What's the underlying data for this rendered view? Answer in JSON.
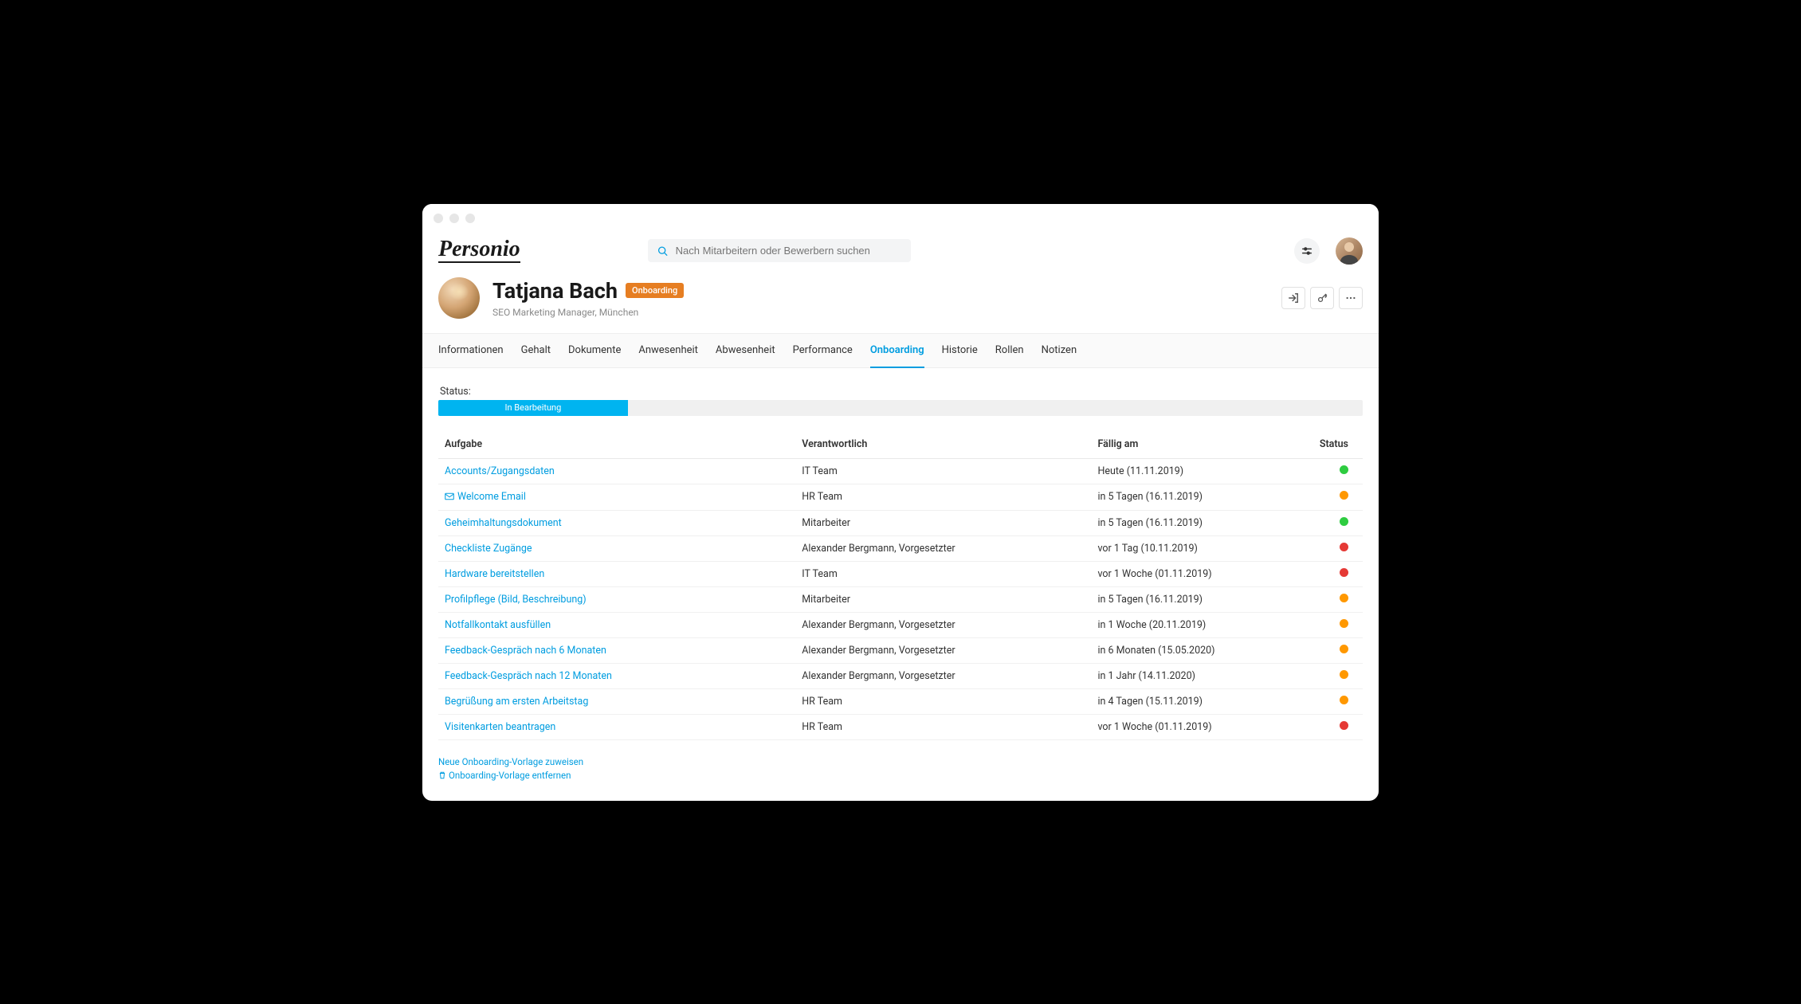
{
  "logo": "Personio",
  "search": {
    "placeholder": "Nach Mitarbeitern oder Bewerbern suchen"
  },
  "profile": {
    "name": "Tatjana Bach",
    "badge": "Onboarding",
    "subtitle": "SEO Marketing Manager, München"
  },
  "tabs": [
    {
      "label": "Informationen",
      "active": false
    },
    {
      "label": "Gehalt",
      "active": false
    },
    {
      "label": "Dokumente",
      "active": false
    },
    {
      "label": "Anwesenheit",
      "active": false
    },
    {
      "label": "Abwesenheit",
      "active": false
    },
    {
      "label": "Performance",
      "active": false
    },
    {
      "label": "Onboarding",
      "active": true
    },
    {
      "label": "Historie",
      "active": false
    },
    {
      "label": "Rollen",
      "active": false
    },
    {
      "label": "Notizen",
      "active": false
    }
  ],
  "status": {
    "label": "Status:",
    "progress_text": "In Bearbeitung"
  },
  "table": {
    "headers": {
      "task": "Aufgabe",
      "responsible": "Verantwortlich",
      "due": "Fällig am",
      "status": "Status"
    },
    "rows": [
      {
        "task": "Accounts/Zugangsdaten",
        "icon": null,
        "responsible": "IT Team",
        "due": "Heute (11.11.2019)",
        "status": "green"
      },
      {
        "task": "Welcome Email",
        "icon": "mail",
        "responsible": "HR Team",
        "due": "in 5 Tagen (16.11.2019)",
        "status": "orange"
      },
      {
        "task": "Geheimhaltungsdokument",
        "icon": null,
        "responsible": "Mitarbeiter",
        "due": "in 5 Tagen (16.11.2019)",
        "status": "green"
      },
      {
        "task": "Checkliste Zugänge",
        "icon": null,
        "responsible": "Alexander Bergmann, Vorgesetzter",
        "due": "vor 1 Tag (10.11.2019)",
        "status": "red"
      },
      {
        "task": "Hardware bereitstellen",
        "icon": null,
        "responsible": "IT Team",
        "due": "vor 1 Woche (01.11.2019)",
        "status": "red"
      },
      {
        "task": "Profilpflege (Bild, Beschreibung)",
        "icon": null,
        "responsible": "Mitarbeiter",
        "due": "in 5 Tagen (16.11.2019)",
        "status": "orange"
      },
      {
        "task": "Notfallkontakt ausfüllen",
        "icon": null,
        "responsible": "Alexander Bergmann, Vorgesetzter",
        "due": "in 1 Woche (20.11.2019)",
        "status": "orange"
      },
      {
        "task": "Feedback-Gespräch nach 6 Monaten",
        "icon": null,
        "responsible": "Alexander Bergmann, Vorgesetzter",
        "due": "in 6 Monaten (15.05.2020)",
        "status": "orange"
      },
      {
        "task": "Feedback-Gespräch nach 12 Monaten",
        "icon": null,
        "responsible": "Alexander Bergmann, Vorgesetzter",
        "due": "in 1 Jahr (14.11.2020)",
        "status": "orange"
      },
      {
        "task": "Begrüßung am ersten Arbeitstag",
        "icon": null,
        "responsible": "HR Team",
        "due": "in 4 Tagen (15.11.2019)",
        "status": "orange"
      },
      {
        "task": "Visitenkarten beantragen",
        "icon": null,
        "responsible": "HR Team",
        "due": "vor 1 Woche (01.11.2019)",
        "status": "red"
      }
    ]
  },
  "footer": {
    "assign": "Neue Onboarding-Vorlage zuweisen",
    "remove": "Onboarding-Vorlage entfernen"
  }
}
